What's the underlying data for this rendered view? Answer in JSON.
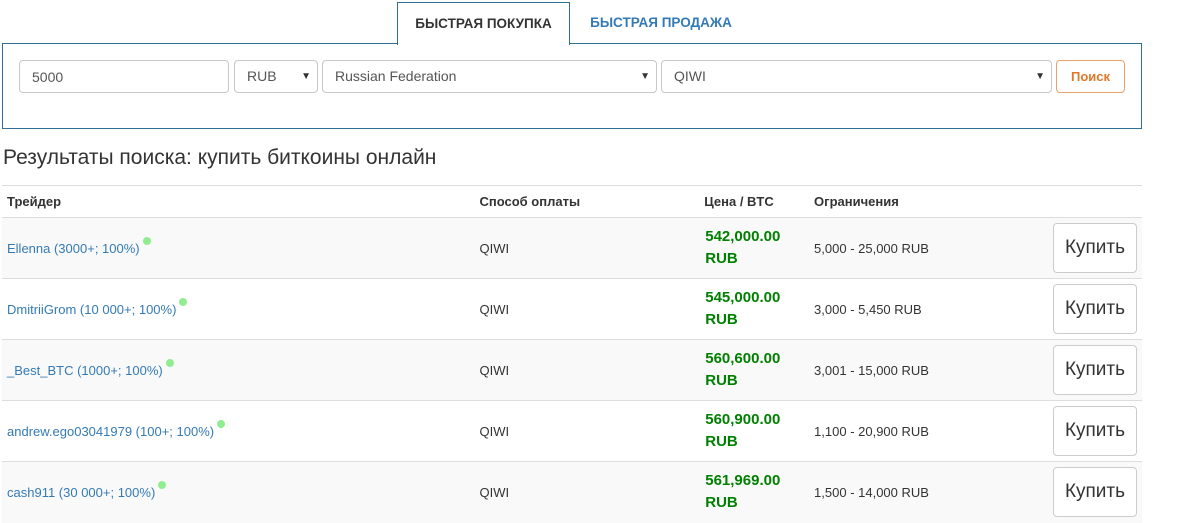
{
  "tabs": {
    "buy_label": "БЫСТРАЯ ПОКУПКА",
    "sell_label": "БЫСТРАЯ ПРОДАЖА"
  },
  "search": {
    "amount_value": "5000",
    "currency_selected": "RUB",
    "country_selected": "Russian Federation",
    "payment_method_selected": "QIWI",
    "button_label": "Поиск"
  },
  "results": {
    "title": "Результаты поиска: купить биткоины онлайн",
    "columns": {
      "trader": "Трейдер",
      "payment_method": "Способ оплаты",
      "price": "Цена / BTC",
      "limits": "Ограничения"
    },
    "rows": [
      {
        "trader": "Ellenna (3000+; 100%)",
        "method": "QIWI",
        "price": "542,000.00",
        "currency": "RUB",
        "limits": "5,000 - 25,000 RUB",
        "action": "Купить"
      },
      {
        "trader": "DmitriiGrom (10 000+; 100%)",
        "method": "QIWI",
        "price": "545,000.00",
        "currency": "RUB",
        "limits": "3,000 - 5,450 RUB",
        "action": "Купить"
      },
      {
        "trader": "_Best_BTC (1000+; 100%)",
        "method": "QIWI",
        "price": "560,600.00",
        "currency": "RUB",
        "limits": "3,001 - 15,000 RUB",
        "action": "Купить"
      },
      {
        "trader": "andrew.ego03041979 (100+; 100%)",
        "method": "QIWI",
        "price": "560,900.00",
        "currency": "RUB",
        "limits": "1,100 - 20,900 RUB",
        "action": "Купить"
      },
      {
        "trader": "cash911 (30 000+; 100%)",
        "method": "QIWI",
        "price": "561,969.00",
        "currency": "RUB",
        "limits": "1,500 - 14,000 RUB",
        "action": "Купить"
      }
    ]
  },
  "colors": {
    "link": "#337ab7",
    "price": "#008000",
    "online_dot": "#90ee90",
    "search_button": "#e0782a",
    "panel_border": "#2f6f93"
  }
}
